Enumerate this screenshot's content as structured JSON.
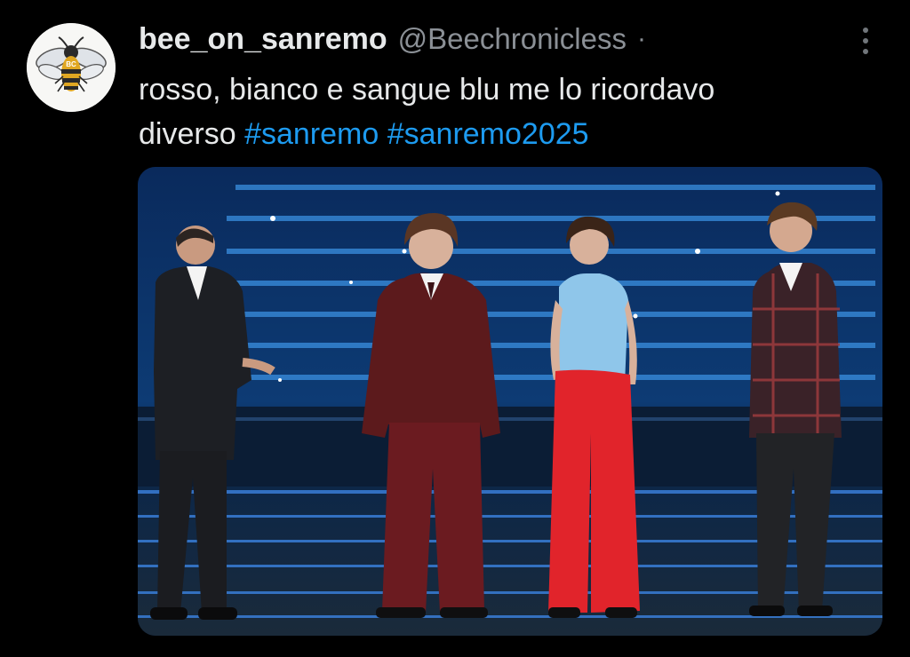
{
  "tweet": {
    "author": {
      "display_name": "bee_on_sanremo",
      "handle": "@Beechronicless",
      "separator": "·",
      "avatar_icon": "bee-icon",
      "avatar_text": "BC"
    },
    "more_icon": "more-vertical-icon",
    "text": {
      "line1": "rosso, bianco e sangue blu me lo ricordavo",
      "line2_prefix": "diverso",
      "hashtags": [
        "#sanremo",
        "#sanremo2025"
      ]
    },
    "media": {
      "type": "photo",
      "accent_colors": {
        "stage_blue": "#1f6fd6",
        "jacket_burgundy": "#5c1a1c",
        "pants_red": "#e1242b",
        "shirt_light_blue": "#8fc6ea"
      }
    },
    "colors": {
      "background": "#000000",
      "text": "#e7e9ea",
      "secondary": "#8b9096",
      "link": "#1d9bf0"
    }
  }
}
